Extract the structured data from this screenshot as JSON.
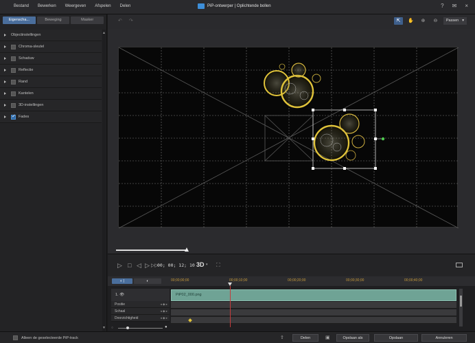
{
  "titlebar": {
    "menu": [
      "Bestand",
      "Bewerken",
      "Weergeven",
      "Afspelen",
      "Delen"
    ],
    "title": "PiP-ontwerper | Oplichtende bollen",
    "controls": [
      "?",
      "✉",
      "×"
    ]
  },
  "left_panel": {
    "tabs": [
      {
        "label": "Eigenscha...",
        "active": true
      },
      {
        "label": "Beweging",
        "active": false
      },
      {
        "label": "Masker",
        "active": false
      }
    ],
    "properties": [
      {
        "label": "Objectinstellingen",
        "has_checkbox": false,
        "checked": false
      },
      {
        "label": "Chroma-sleutel",
        "has_checkbox": true,
        "checked": false
      },
      {
        "label": "Schaduw",
        "has_checkbox": true,
        "checked": false
      },
      {
        "label": "Reflectie",
        "has_checkbox": true,
        "checked": false
      },
      {
        "label": "Rand",
        "has_checkbox": true,
        "checked": false
      },
      {
        "label": "Kantelen",
        "has_checkbox": true,
        "checked": false
      },
      {
        "label": "3D-instellingen",
        "has_checkbox": true,
        "checked": false
      },
      {
        "label": "Fades",
        "has_checkbox": true,
        "checked": true
      }
    ]
  },
  "preview_toolbar": {
    "undo": "↶",
    "redo": "↷",
    "tools": [
      "⇱",
      "✋",
      "⊕",
      "⊖"
    ],
    "fit_label": "Passen",
    "fit_caret": "▾"
  },
  "playback": {
    "timecode": "00; 00; 12; 10",
    "mode_badge": "3D",
    "mode_caret": "▾",
    "buttons": [
      "▷",
      "□",
      "◁",
      "▷",
      "▷▷"
    ]
  },
  "timeline": {
    "mode_buttons": [
      "◐ |",
      "◐"
    ],
    "ruler": [
      "00;00;00;00",
      "00;00;10;00",
      "00;00;20;00",
      "00;00;30;00",
      "00;00;40;00"
    ],
    "track_label": "1. 👁",
    "clip_name": "PiP02_000.png",
    "key_rows": [
      "Positie",
      "Schaal",
      "Doorzichtigheid"
    ],
    "key_buttons": "◂ ◆ ▸"
  },
  "bottom_bar": {
    "checkbox_label": "Alleen de geselecteerde PiP-track",
    "buttons": [
      "Delen",
      "Opslaan als",
      "Opslaan",
      "Annuleren"
    ]
  },
  "colors": {
    "accent": "#4a6e9c",
    "clip": "#6fa395",
    "playhead": "#c43c3c",
    "glow": "#e0c33a"
  }
}
